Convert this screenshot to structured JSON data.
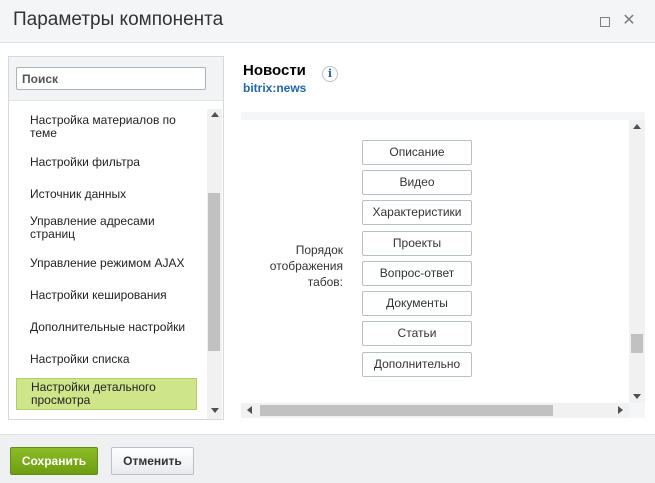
{
  "dialog": {
    "title": "Параметры компонента"
  },
  "sidebar": {
    "search_placeholder": "Поиск",
    "items": [
      {
        "label": "Настройка материалов по теме"
      },
      {
        "label": "Настройки фильтра"
      },
      {
        "label": "Источник данных"
      },
      {
        "label": "Управление адресами страниц"
      },
      {
        "label": "Управление режимом AJAX"
      },
      {
        "label": "Настройки кеширования"
      },
      {
        "label": "Дополнительные настройки"
      },
      {
        "label": "Настройки списка"
      },
      {
        "label": "Настройки детального просмотра",
        "active": true
      }
    ]
  },
  "component": {
    "title": "Новости",
    "code": "bitrix:news"
  },
  "tab_order": {
    "label": "Порядок отображения табов:",
    "tabs": [
      "Описание",
      "Видео",
      "Характеристики",
      "Проекты",
      "Вопрос-ответ",
      "Документы",
      "Статьи",
      "Дополнительно"
    ]
  },
  "footer": {
    "save_label": "Сохранить",
    "cancel_label": "Отменить"
  },
  "colors": {
    "save_button": "#7cab1c",
    "active_item": "#cfe58a",
    "link_blue": "#2067b0"
  },
  "icons": [
    "maximize-icon",
    "close-icon",
    "info-icon",
    "scroll-arrow-icon"
  ]
}
